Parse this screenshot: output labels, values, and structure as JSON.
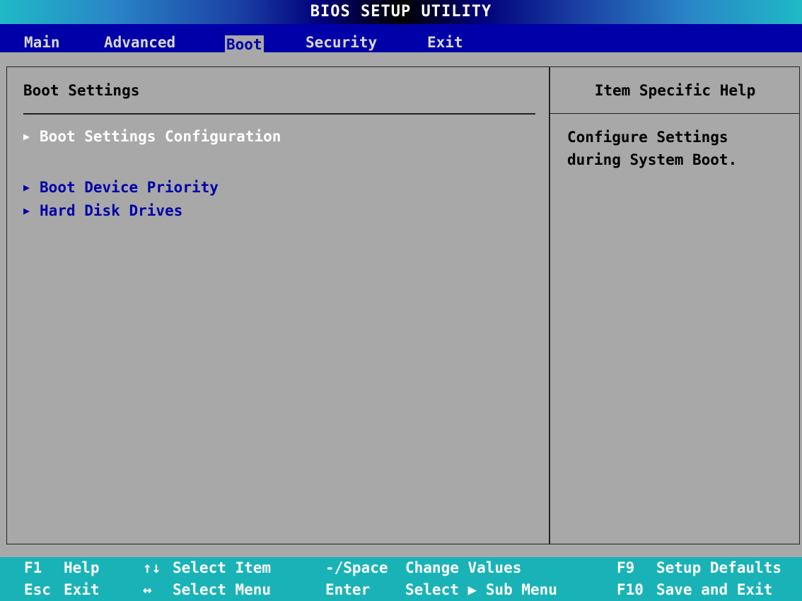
{
  "title": "BIOS SETUP UTILITY",
  "menu": [
    {
      "label": "Main"
    },
    {
      "label": "Advanced"
    },
    {
      "label": "Boot"
    },
    {
      "label": "Security"
    },
    {
      "label": "Exit"
    }
  ],
  "active_menu": "Boot",
  "section_title": "Boot Settings",
  "items": [
    {
      "label": "Boot Settings Configuration",
      "selected": true
    },
    {
      "label": "Boot Device Priority",
      "selected": false
    },
    {
      "label": "Hard Disk Drives",
      "selected": false
    }
  ],
  "help": {
    "title": "Item Specific Help",
    "lines": [
      "Configure Settings",
      "during System Boot."
    ]
  },
  "footer": {
    "row1": [
      {
        "key": "F1",
        "action": "Help"
      },
      {
        "key": "↑↓",
        "action": "Select Item"
      },
      {
        "key": "-/Space",
        "action": "Change Values"
      },
      {
        "key": "F9",
        "action": "Setup Defaults"
      }
    ],
    "row2": [
      {
        "key": "Esc",
        "action": "Exit"
      },
      {
        "key": "↔",
        "action": "Select Menu"
      },
      {
        "key": "Enter",
        "action": "Select ▶ Sub Menu"
      },
      {
        "key": "F10",
        "action": "Save and Exit"
      }
    ]
  },
  "colors": {
    "menubar": "#0000a8",
    "background": "#a8a8a8",
    "footer": "#19b3b7",
    "item_text": "#0000a8",
    "selected_text": "#ffffff"
  }
}
